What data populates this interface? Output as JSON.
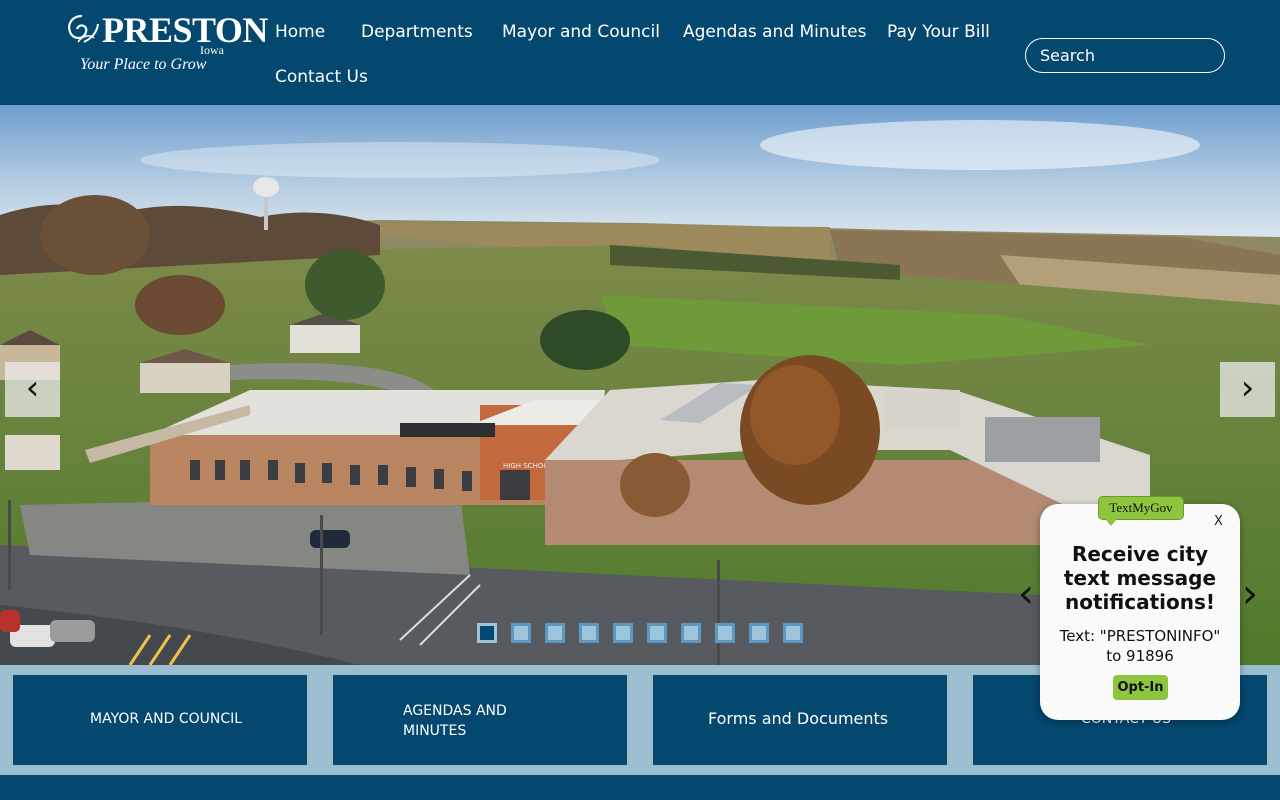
{
  "header": {
    "logo": {
      "name": "PRESTON",
      "state": "Iowa",
      "tagline": "Your Place to Grow"
    },
    "nav": [
      "Home",
      "Departments",
      "Mayor and Council",
      "Agendas and Minutes",
      "Pay Your Bill",
      "Contact Us"
    ],
    "search": {
      "placeholder": "Search",
      "value": ""
    }
  },
  "hero": {
    "prev_icon": "chevron-left-icon",
    "next_icon": "chevron-right-icon",
    "slide_count": 10,
    "active_slide": 1,
    "building_sign": "HIGH SCHOOL"
  },
  "quick_links": [
    "MAYOR AND COUNCIL",
    "AGENDAS AND MINUTES",
    "Forms and Documents",
    "CONTACT US"
  ],
  "textmygov": {
    "badge": "TextMyGov",
    "close_label": "X",
    "title": "Receive city text message notifications!",
    "instruction": "Text: \"PRESTONINFO\" to 91896",
    "button": "Opt-In"
  },
  "colors": {
    "brand_navy": "#04476f",
    "band_blue": "#9bbfd0",
    "accent_green": "#8dc53e"
  }
}
